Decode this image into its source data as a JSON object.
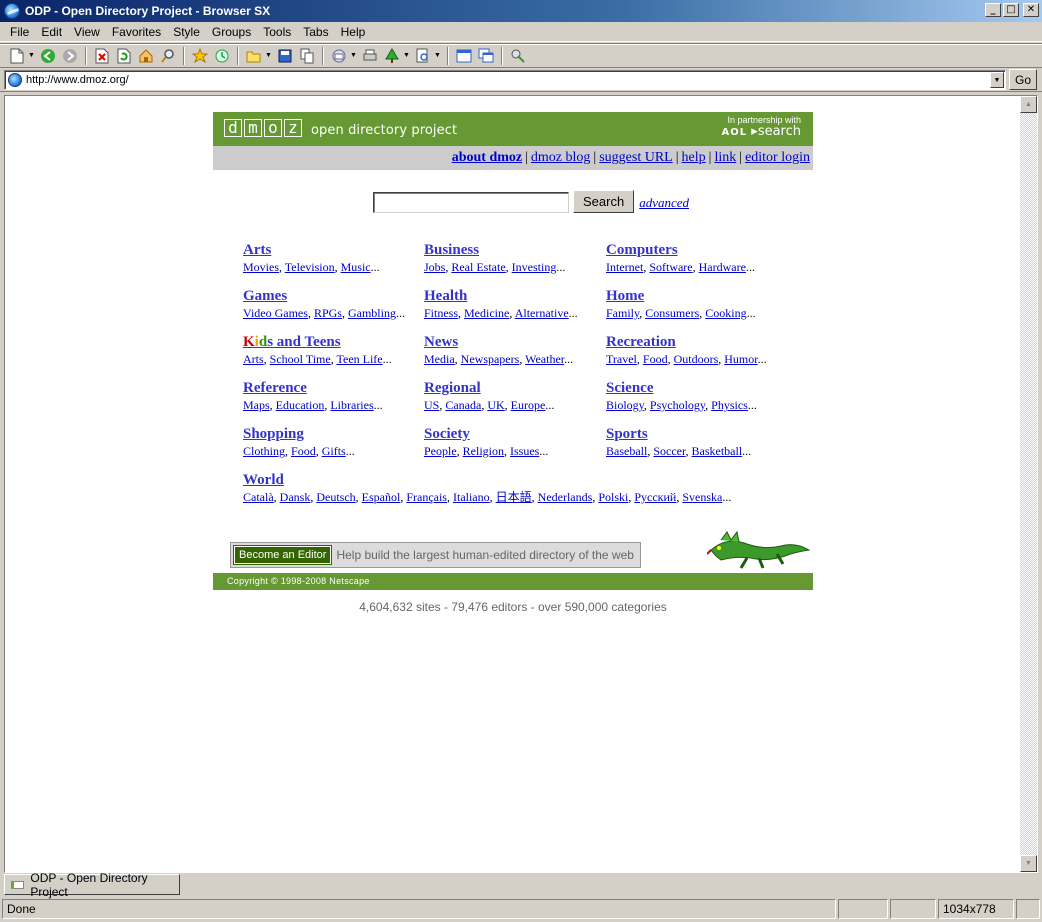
{
  "window": {
    "title": "ODP - Open Directory Project - Browser SX",
    "buttons": {
      "minimize": "_",
      "maximize": "□",
      "close": "✕"
    }
  },
  "menu": [
    "File",
    "Edit",
    "View",
    "Favorites",
    "Style",
    "Groups",
    "Tools",
    "Tabs",
    "Help"
  ],
  "address": {
    "url": "http://www.dmoz.org/",
    "go_label": "Go"
  },
  "page": {
    "logo_letters": [
      "d",
      "m",
      "o",
      "z"
    ],
    "logo_tagline": "open directory project",
    "partner_line1": "In partnership with",
    "partner_aol": "AOL",
    "partner_search": "search",
    "nav": {
      "about": "about dmoz",
      "blog": "dmoz blog",
      "suggest": "suggest URL",
      "help": "help",
      "link": "link",
      "editor_login": "editor login"
    },
    "search": {
      "value": "",
      "button": "Search",
      "advanced": "advanced"
    },
    "categories": [
      {
        "title": "Arts",
        "subs": [
          "Movies",
          "Television",
          "Music"
        ]
      },
      {
        "title": "Business",
        "subs": [
          "Jobs",
          "Real Estate",
          "Investing"
        ]
      },
      {
        "title": "Computers",
        "subs": [
          "Internet",
          "Software",
          "Hardware"
        ]
      },
      {
        "title": "Games",
        "subs": [
          "Video Games",
          "RPGs",
          "Gambling"
        ]
      },
      {
        "title": "Health",
        "subs": [
          "Fitness",
          "Medicine",
          "Alternative"
        ]
      },
      {
        "title": "Home",
        "subs": [
          "Family",
          "Consumers",
          "Cooking"
        ]
      },
      {
        "title_letters": [
          "K",
          "i",
          "d",
          "s"
        ],
        "title_rest": " and Teens",
        "subs": [
          "Arts",
          "School Time",
          "Teen Life"
        ]
      },
      {
        "title": "News",
        "subs": [
          "Media",
          "Newspapers",
          "Weather"
        ]
      },
      {
        "title": "Recreation",
        "subs": [
          "Travel",
          "Food",
          "Outdoors",
          "Humor"
        ]
      },
      {
        "title": "Reference",
        "subs": [
          "Maps",
          "Education",
          "Libraries"
        ]
      },
      {
        "title": "Regional",
        "subs": [
          "US",
          "Canada",
          "UK",
          "Europe"
        ]
      },
      {
        "title": "Science",
        "subs": [
          "Biology",
          "Psychology",
          "Physics"
        ]
      },
      {
        "title": "Shopping",
        "subs": [
          "Clothing",
          "Food",
          "Gifts"
        ]
      },
      {
        "title": "Society",
        "subs": [
          "People",
          "Religion",
          "Issues"
        ]
      },
      {
        "title": "Sports",
        "subs": [
          "Baseball",
          "Soccer",
          "Basketball"
        ]
      },
      {
        "title": "World",
        "subs": [
          "Català",
          "Dansk",
          "Deutsch",
          "Español",
          "Français",
          "Italiano",
          "日本語",
          "Nederlands",
          "Polski",
          "Русский",
          "Svenska"
        ]
      }
    ],
    "editor_button": "Become an Editor",
    "editor_text": "Help build the largest human-edited directory of the web",
    "copyright": "Copyright © 1998-2008 Netscape",
    "stats": "4,604,632 sites - 79,476 editors - over 590,000 categories"
  },
  "tab": {
    "label": "ODP - Open Directory Project"
  },
  "status": {
    "text": "Done",
    "size": "1034x778"
  },
  "colors": {
    "dmoz_green": "#669933",
    "nav_gray": "#cccccc",
    "link_blue": "#3333cc"
  },
  "icons": [
    "new-page-icon",
    "back-icon",
    "forward-icon",
    "stop-icon",
    "refresh-icon",
    "home-icon",
    "search-icon",
    "favorites-icon",
    "history-icon",
    "open-icon",
    "save-icon",
    "copy-icon",
    "mail-icon",
    "print-icon",
    "tree-icon",
    "zoom-icon",
    "window-icon",
    "cascade-icon",
    "tools-icon"
  ]
}
